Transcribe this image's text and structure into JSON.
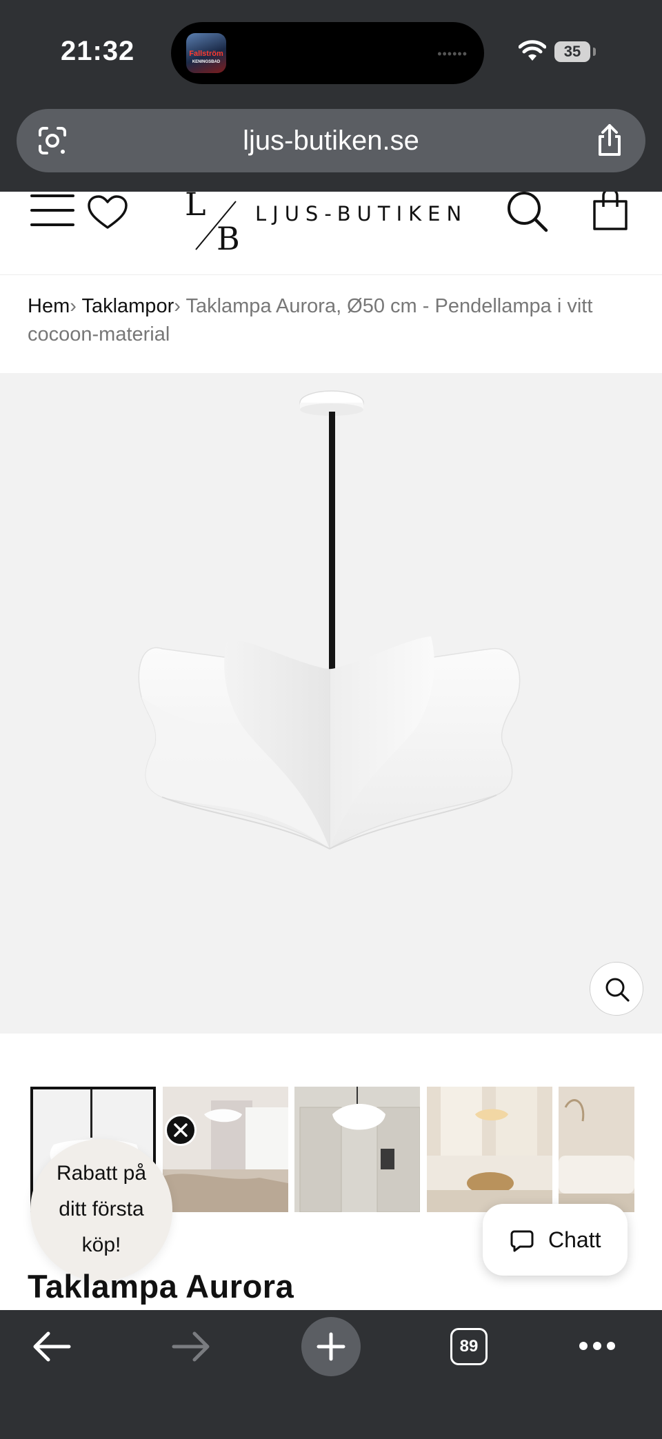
{
  "status_bar": {
    "time": "21:32",
    "battery": "35",
    "island_app": {
      "title": "Fallström",
      "subtitle": "KENINGSBAD"
    }
  },
  "browser": {
    "url": "ljus-butiken.se",
    "open_tabs": "89"
  },
  "site": {
    "logo_text": "LJUS-BUTIKEN",
    "logo_monogram": "LB",
    "breadcrumb": {
      "home": "Hem",
      "category": "Taklampor",
      "separator": "›",
      "current": "Taklampa Aurora, Ø50 cm - Pendellampa i vitt cocoon-material"
    }
  },
  "gallery": {
    "thumbnail_count": 5,
    "selected_index": 0
  },
  "promo": {
    "line1": "Rabatt på",
    "line2": "ditt första",
    "line3": "köp!"
  },
  "chat": {
    "label": "Chatt"
  },
  "product": {
    "title": "Taklampa Aurora"
  },
  "colors": {
    "chrome_dark": "#2f3134",
    "url_bar": "#5b5e63",
    "hero_bg": "#f2f2f2",
    "promo_bg": "#f1eeea"
  }
}
